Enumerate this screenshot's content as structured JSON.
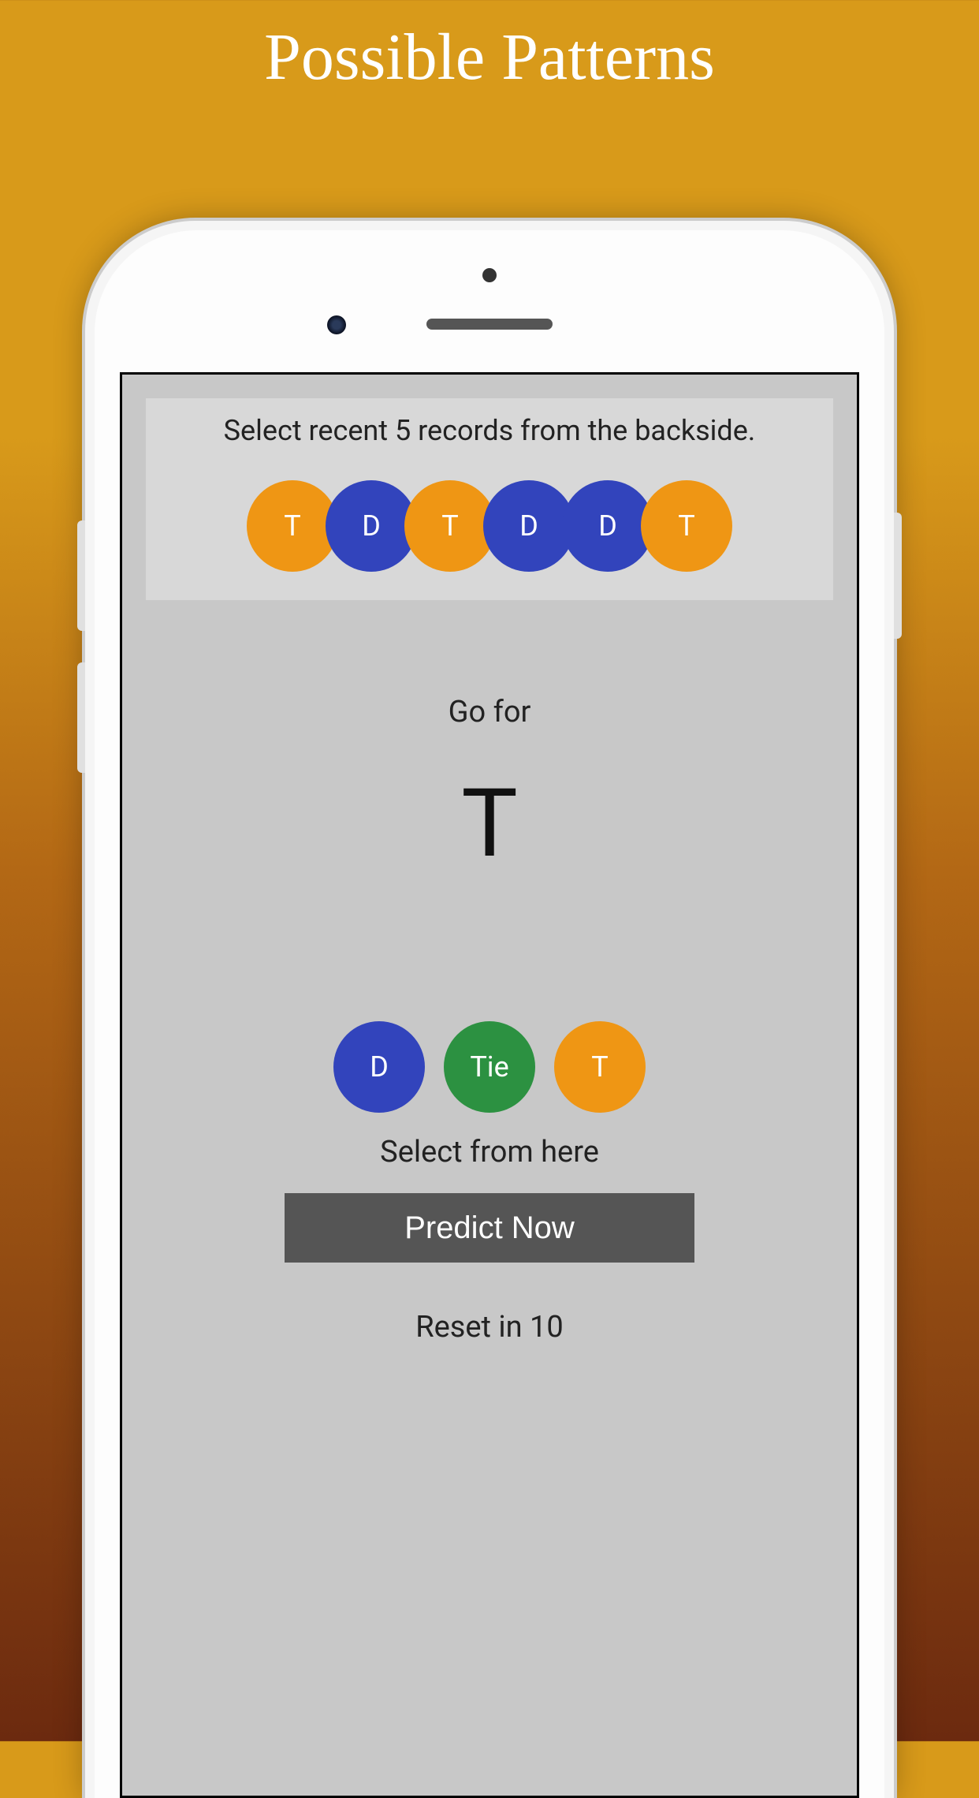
{
  "page": {
    "title": "Possible Patterns"
  },
  "records": {
    "instruction": "Select recent 5 records from the backside.",
    "items": [
      {
        "label": "T",
        "color": "orange"
      },
      {
        "label": "D",
        "color": "blue"
      },
      {
        "label": "T",
        "color": "orange"
      },
      {
        "label": "D",
        "color": "blue"
      },
      {
        "label": "D",
        "color": "blue"
      },
      {
        "label": "T",
        "color": "orange"
      }
    ]
  },
  "prediction": {
    "go_for_label": "Go for",
    "go_for_value": "T"
  },
  "select": {
    "options": [
      {
        "label": "D",
        "color": "blue"
      },
      {
        "label": "Tie",
        "color": "green"
      },
      {
        "label": "T",
        "color": "orange"
      }
    ],
    "instruction": "Select from here"
  },
  "actions": {
    "predict_label": "Predict Now",
    "reset_label": "Reset in 10"
  },
  "colors": {
    "orange": "#ef9614",
    "blue": "#3244bc",
    "green": "#2c9141"
  }
}
